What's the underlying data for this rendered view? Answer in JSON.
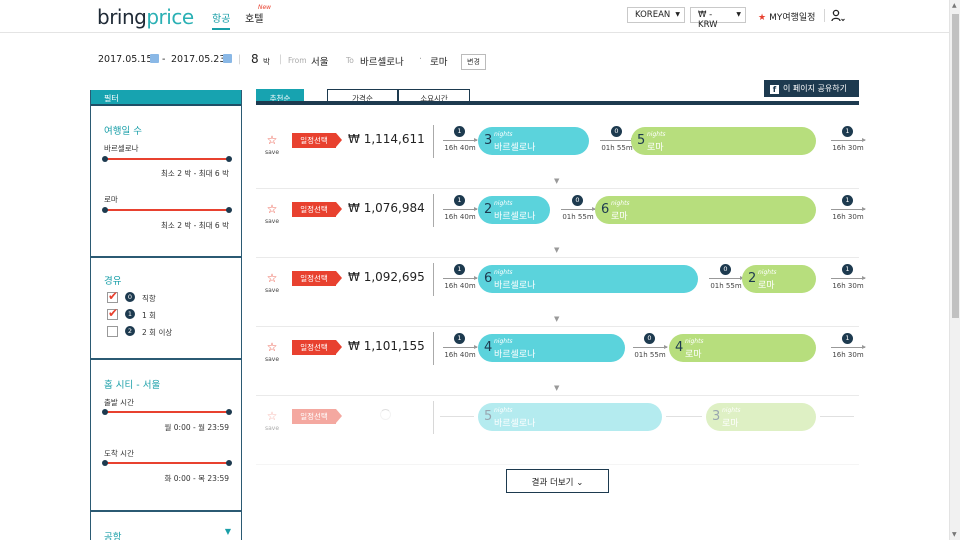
{
  "header": {
    "logo_a": "bring",
    "logo_b": "price",
    "nav_flight": "항공",
    "nav_hotel": "호텔",
    "new_badge": "New",
    "language": "KOREAN",
    "currency": "₩ - KRW",
    "my_trips": "MY여행일정",
    "icons": [
      "star-icon",
      "user-icon",
      "chevron-down-icon"
    ]
  },
  "summary": {
    "date_start": "2017.05.15",
    "date_start_day": "월",
    "dash": "-",
    "date_end": "2017.05.23",
    "date_end_day": "화",
    "nights": "8",
    "nights_unit": "박",
    "from_label": "From",
    "from_city": "서울",
    "to_label": "To",
    "to_city": "바르셀로나",
    "sep": "·",
    "to_city2": "로마",
    "change_label": "변경"
  },
  "sidebar": {
    "header": "필터",
    "days": {
      "title": "여행일 수",
      "cities": [
        {
          "name": "바르셀로나",
          "range": "최소 2 박 - 최대 6 박"
        },
        {
          "name": "로마",
          "range": "최소 2 박 - 최대 6 박"
        }
      ]
    },
    "stops": {
      "title": "경유",
      "options": [
        {
          "num": "0",
          "label": "직항",
          "checked": true
        },
        {
          "num": "1",
          "label": "1 회",
          "checked": true
        },
        {
          "num": "2",
          "label": "2 회 이상",
          "checked": false
        }
      ]
    },
    "home": {
      "title": "홈 시티 - 서울",
      "depart_label": "출발 시간",
      "depart_range": "월 0:00 - 월 23:59",
      "arrive_label": "도착 시간",
      "arrive_range": "화 0:00 - 목 23:59"
    },
    "airport": {
      "title": "공항"
    }
  },
  "tabs": [
    {
      "label": "추천순",
      "active": true
    },
    {
      "label": "가격순",
      "active": false
    },
    {
      "label": "소요시간",
      "active": false
    }
  ],
  "share_label": "이 페이지 공유하기",
  "result_common": {
    "save_label": "save",
    "pick_label": "일정선택",
    "currency_symbol": "₩",
    "nights_word": "nights",
    "stops_icon": "stop-count-icon"
  },
  "results": [
    {
      "price": "1,114,611",
      "legs": [
        {
          "stops": "1",
          "duration": "16h 40m"
        },
        {
          "stops": "0",
          "duration": "01h 55m"
        },
        {
          "stops": "1",
          "duration": "16h 30m"
        }
      ],
      "stays": [
        {
          "nights": "3",
          "city": "바르셀로나"
        },
        {
          "nights": "5",
          "city": "로마"
        }
      ]
    },
    {
      "price": "1,076,984",
      "legs": [
        {
          "stops": "1",
          "duration": "16h 40m"
        },
        {
          "stops": "0",
          "duration": "01h 55m"
        },
        {
          "stops": "1",
          "duration": "16h 30m"
        }
      ],
      "stays": [
        {
          "nights": "2",
          "city": "바르셀로나"
        },
        {
          "nights": "6",
          "city": "로마"
        }
      ]
    },
    {
      "price": "1,092,695",
      "legs": [
        {
          "stops": "1",
          "duration": "16h 40m"
        },
        {
          "stops": "0",
          "duration": "01h 55m"
        },
        {
          "stops": "1",
          "duration": "16h 30m"
        }
      ],
      "stays": [
        {
          "nights": "6",
          "city": "바르셀로나"
        },
        {
          "nights": "2",
          "city": "로마"
        }
      ]
    },
    {
      "price": "1,101,155",
      "legs": [
        {
          "stops": "1",
          "duration": "16h 40m"
        },
        {
          "stops": "0",
          "duration": "01h 55m"
        },
        {
          "stops": "1",
          "duration": "16h 30m"
        }
      ],
      "stays": [
        {
          "nights": "4",
          "city": "바르셀로나"
        },
        {
          "nights": "4",
          "city": "로마"
        }
      ]
    },
    {
      "loading": true,
      "stays": [
        {
          "nights": "5",
          "city": "바르셀로나"
        },
        {
          "nights": "3",
          "city": "로마"
        }
      ]
    }
  ],
  "more_label": "결과 더보기",
  "colors": {
    "accent": "#17a3b0",
    "red": "#e8412f",
    "navy": "#1d3a4f",
    "barcelona_pill": "#5bd3dc",
    "rome_pill": "#b7de7d"
  }
}
